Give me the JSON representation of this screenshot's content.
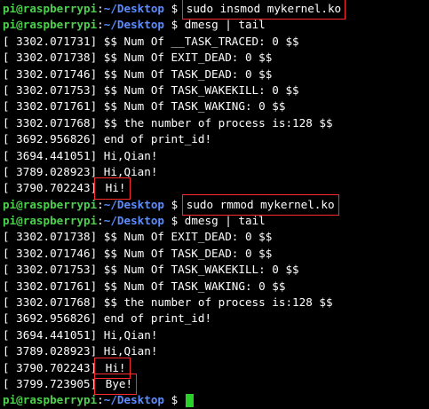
{
  "prompt": {
    "user_host": "pi@raspberrypi",
    "colon": ":",
    "path": "~/Desktop",
    "symbol": " $ "
  },
  "block1": {
    "cmd_insmod": "sudo insmod mykernel.ko",
    "cmd_dmesg": "dmesg | tail",
    "log": [
      {
        "ts": "[ 3302.071731]",
        "msg": " $$ Num Of __TASK_TRACED: 0 $$"
      },
      {
        "ts": "[ 3302.071738]",
        "msg": " $$ Num Of EXIT_DEAD: 0 $$"
      },
      {
        "ts": "[ 3302.071746]",
        "msg": " $$ Num Of TASK_DEAD: 0 $$"
      },
      {
        "ts": "[ 3302.071753]",
        "msg": " $$ Num Of TASK_WAKEKILL: 0 $$"
      },
      {
        "ts": "[ 3302.071761]",
        "msg": " $$ Num Of TASK_WAKING: 0 $$"
      },
      {
        "ts": "[ 3302.071768]",
        "msg": " $$ the number of process is:128 $$"
      },
      {
        "ts": "[ 3692.956826]",
        "msg": " end of print_id!"
      },
      {
        "ts": "[ 3694.441051]",
        "msg": " Hi,Qian!"
      },
      {
        "ts": "[ 3789.028923]",
        "msg": " Hi,Qian!"
      }
    ],
    "last_ts": "[ 3790.702243]",
    "last_msg": " Hi!"
  },
  "block2": {
    "cmd_rmmod": "sudo rmmod mykernel.ko",
    "cmd_dmesg": "dmesg | tail",
    "log": [
      {
        "ts": "[ 3302.071738]",
        "msg": " $$ Num Of EXIT_DEAD: 0 $$"
      },
      {
        "ts": "[ 3302.071746]",
        "msg": " $$ Num Of TASK_DEAD: 0 $$"
      },
      {
        "ts": "[ 3302.071753]",
        "msg": " $$ Num Of TASK_WAKEKILL: 0 $$"
      },
      {
        "ts": "[ 3302.071761]",
        "msg": " $$ Num Of TASK_WAKING: 0 $$"
      },
      {
        "ts": "[ 3302.071768]",
        "msg": " $$ the number of process is:128 $$"
      },
      {
        "ts": "[ 3692.956826]",
        "msg": " end of print_id!"
      },
      {
        "ts": "[ 3694.441051]",
        "msg": " Hi,Qian!"
      },
      {
        "ts": "[ 3789.028923]",
        "msg": " Hi,Qian!"
      }
    ],
    "hi_ts": "[ 3790.702243]",
    "hi_msg": " Hi!",
    "bye_ts": "[ 3799.723905]",
    "bye_msg": " Bye!"
  },
  "colors": {
    "background": "#000000",
    "prompt_user": "#4cd14c",
    "prompt_path": "#5c8cff",
    "text": "#ffffff",
    "highlight_box": "#ff2a2a",
    "cursor": "#2bd12b"
  }
}
